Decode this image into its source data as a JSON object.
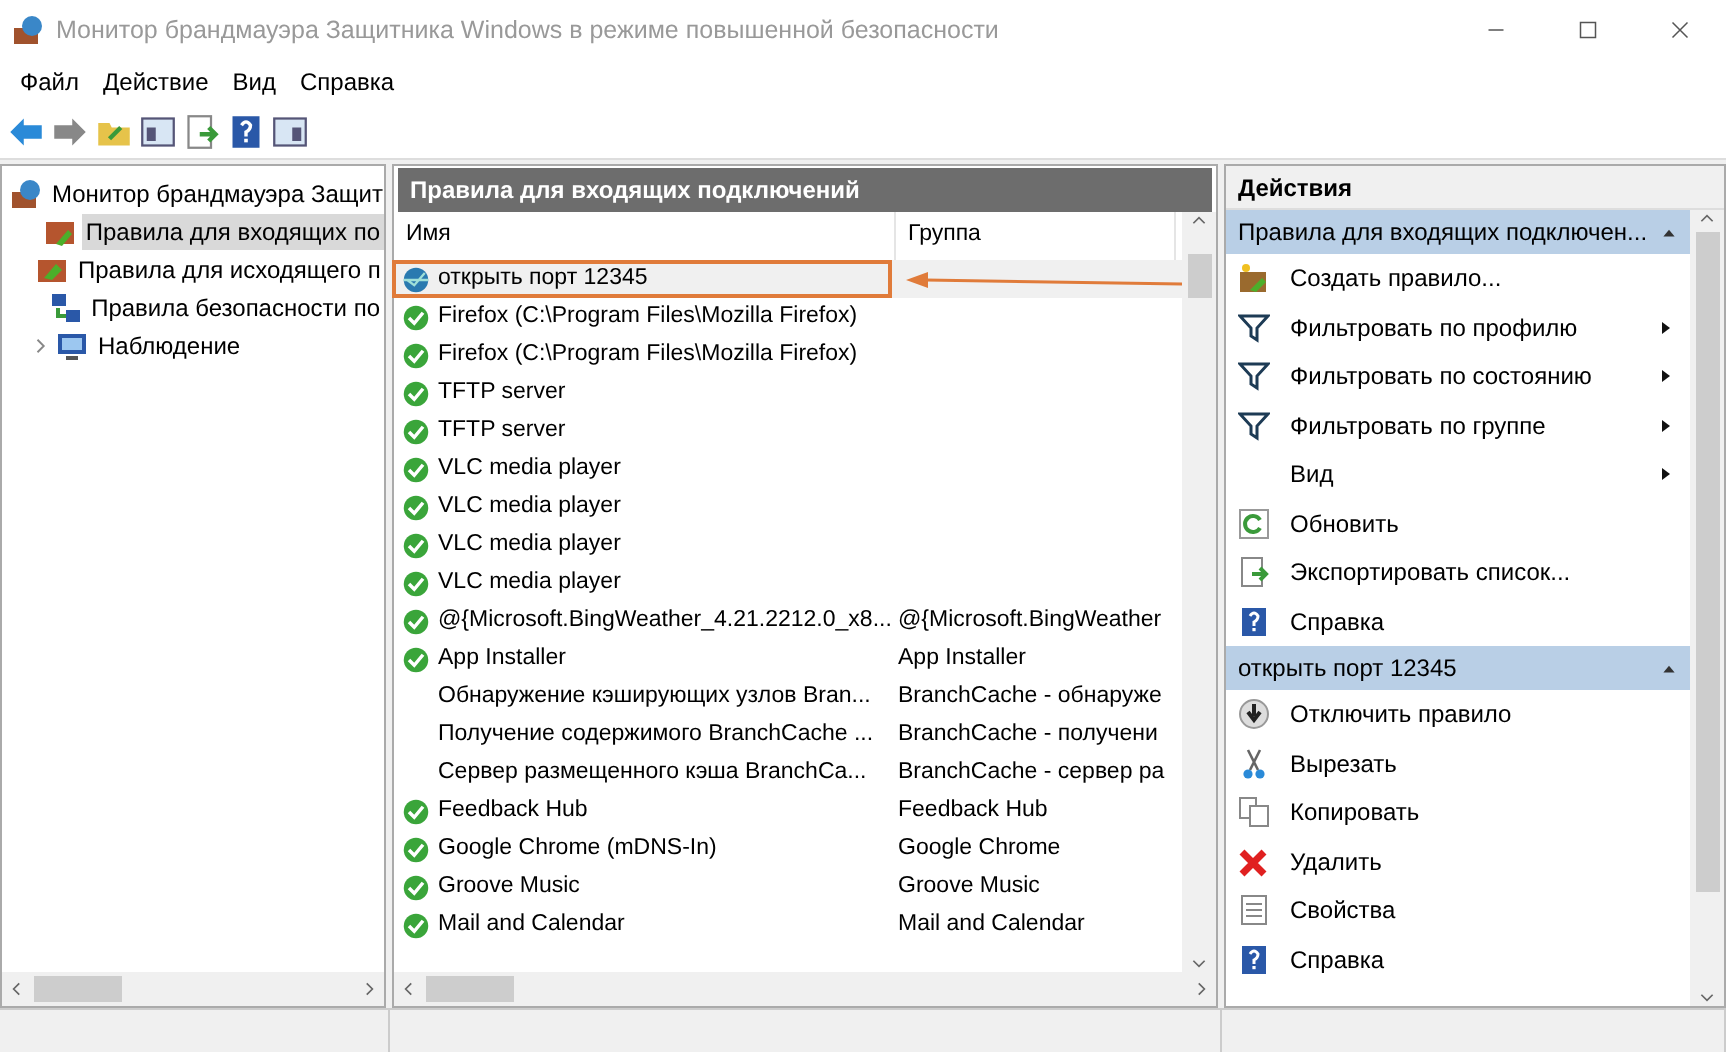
{
  "window": {
    "title": "Монитор брандмауэра Защитника Windows в режиме повышенной безопасности"
  },
  "menu": [
    "Файл",
    "Действие",
    "Вид",
    "Справка"
  ],
  "tree": [
    {
      "label": "Монитор брандмауэра Защит",
      "selected": false,
      "children": [
        {
          "label": "Правила для входящих по",
          "selected": true
        },
        {
          "label": "Правила для исходящего п",
          "selected": false
        },
        {
          "label": "Правила безопасности по",
          "selected": false
        },
        {
          "label": "Наблюдение",
          "selected": false,
          "expanded": false
        }
      ]
    }
  ],
  "rules_panel": {
    "title": "Правила для входящих подключений",
    "columns": [
      "Имя",
      "Группа"
    ],
    "rows": [
      {
        "name": "открыть порт 12345",
        "group": "",
        "kind": "custom",
        "selected": true
      },
      {
        "name": "Firefox (C:\\Program Files\\Mozilla Firefox)",
        "group": "",
        "kind": "enabled",
        "selected": false
      },
      {
        "name": "Firefox (C:\\Program Files\\Mozilla Firefox)",
        "group": "",
        "kind": "enabled",
        "selected": false
      },
      {
        "name": "TFTP server",
        "group": "",
        "kind": "enabled",
        "selected": false
      },
      {
        "name": "TFTP server",
        "group": "",
        "kind": "enabled",
        "selected": false
      },
      {
        "name": "VLC media player",
        "group": "",
        "kind": "enabled",
        "selected": false
      },
      {
        "name": "VLC media player",
        "group": "",
        "kind": "enabled",
        "selected": false
      },
      {
        "name": "VLC media player",
        "group": "",
        "kind": "enabled",
        "selected": false
      },
      {
        "name": "VLC media player",
        "group": "",
        "kind": "enabled",
        "selected": false
      },
      {
        "name": "@{Microsoft.BingWeather_4.21.2212.0_x8...",
        "group": "@{Microsoft.BingWeather",
        "kind": "enabled",
        "selected": false
      },
      {
        "name": "App Installer",
        "group": "App Installer",
        "kind": "enabled",
        "selected": false
      },
      {
        "name": "Обнаружение кэширующих узлов Bran...",
        "group": "BranchCache - обнаруже",
        "kind": "disabled",
        "selected": false
      },
      {
        "name": "Получение содержимого BranchCache ...",
        "group": "BranchCache - получени",
        "kind": "disabled",
        "selected": false
      },
      {
        "name": "Сервер размещенного кэша BranchCa...",
        "group": "BranchCache - сервер ра",
        "kind": "disabled",
        "selected": false
      },
      {
        "name": "Feedback Hub",
        "group": "Feedback Hub",
        "kind": "enabled",
        "selected": false
      },
      {
        "name": "Google Chrome (mDNS-In)",
        "group": "Google Chrome",
        "kind": "enabled",
        "selected": false
      },
      {
        "name": "Groove Music",
        "group": "Groove Music",
        "kind": "enabled",
        "selected": false
      },
      {
        "name": "Mail and Calendar",
        "group": "Mail and Calendar",
        "kind": "enabled",
        "selected": false
      }
    ]
  },
  "actions": {
    "title": "Действия",
    "sections": [
      {
        "title": "Правила для входящих подключен...",
        "expanded": true,
        "items": [
          {
            "label": "Создать правило...",
            "submenu": false
          },
          {
            "label": "Фильтровать по профилю",
            "submenu": true
          },
          {
            "label": "Фильтровать по состоянию",
            "submenu": true
          },
          {
            "label": "Фильтровать по группе",
            "submenu": true
          },
          {
            "label": "Вид",
            "submenu": true
          },
          {
            "label": "Обновить",
            "submenu": false
          },
          {
            "label": "Экспортировать список...",
            "submenu": false
          },
          {
            "label": "Справка",
            "submenu": false
          }
        ]
      },
      {
        "title": "открыть порт 12345",
        "expanded": true,
        "items": [
          {
            "label": "Отключить правило",
            "submenu": false
          },
          {
            "label": "Вырезать",
            "submenu": false
          },
          {
            "label": "Копировать",
            "submenu": false
          },
          {
            "label": "Удалить",
            "submenu": false
          },
          {
            "label": "Свойства",
            "submenu": false
          },
          {
            "label": "Справка",
            "submenu": false
          }
        ]
      }
    ]
  }
}
